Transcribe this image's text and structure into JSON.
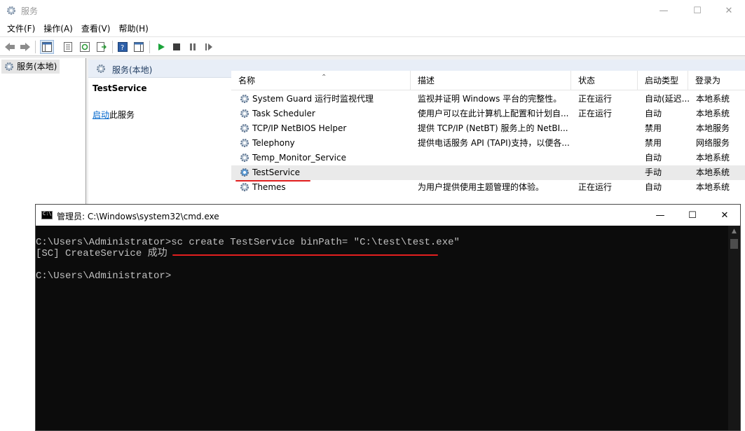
{
  "services_window": {
    "title": "服务",
    "menu": [
      "文件(F)",
      "操作(A)",
      "查看(V)",
      "帮助(H)"
    ],
    "tree_item": "服务(本地)",
    "pane_header": "服务(本地)",
    "detail": {
      "service_name": "TestService",
      "start_link": "启动",
      "start_suffix": "此服务"
    },
    "columns": [
      "名称",
      "描述",
      "状态",
      "启动类型",
      "登录为"
    ],
    "rows": [
      {
        "name": "System Guard 运行时监视代理",
        "desc": "监视并证明 Windows 平台的完整性。",
        "status": "正在运行",
        "startup": "自动(延迟...",
        "logon": "本地系统"
      },
      {
        "name": "Task Scheduler",
        "desc": "使用户可以在此计算机上配置和计划自...",
        "status": "正在运行",
        "startup": "自动",
        "logon": "本地系统"
      },
      {
        "name": "TCP/IP NetBIOS Helper",
        "desc": "提供 TCP/IP (NetBT) 服务上的 NetBI...",
        "status": "",
        "startup": "禁用",
        "logon": "本地服务"
      },
      {
        "name": "Telephony",
        "desc": "提供电话服务 API (TAPI)支持，以便各...",
        "status": "",
        "startup": "禁用",
        "logon": "网络服务"
      },
      {
        "name": "Temp_Monitor_Service",
        "desc": "",
        "status": "",
        "startup": "自动",
        "logon": "本地系统"
      },
      {
        "name": "TestService",
        "desc": "",
        "status": "",
        "startup": "手动",
        "logon": "本地系统"
      },
      {
        "name": "Themes",
        "desc": "为用户提供使用主题管理的体验。",
        "status": "正在运行",
        "startup": "自动",
        "logon": "本地系统"
      }
    ]
  },
  "cmd_window": {
    "title": "管理员: C:\\Windows\\system32\\cmd.exe",
    "lines": [
      "C:\\Users\\Administrator>sc create TestService binPath= \"C:\\test\\test.exe\"",
      "[SC] CreateService 成功",
      "",
      "C:\\Users\\Administrator>"
    ]
  },
  "colors": {
    "highlight_underline": "#e21f1f",
    "console_bg": "#0c0c0c",
    "console_fg": "#c0c0c0",
    "link": "#0066cc"
  },
  "icons": [
    "gear-icon",
    "back-icon",
    "forward-icon",
    "play-icon",
    "stop-icon",
    "pause-icon",
    "resume-icon",
    "help-icon"
  ]
}
